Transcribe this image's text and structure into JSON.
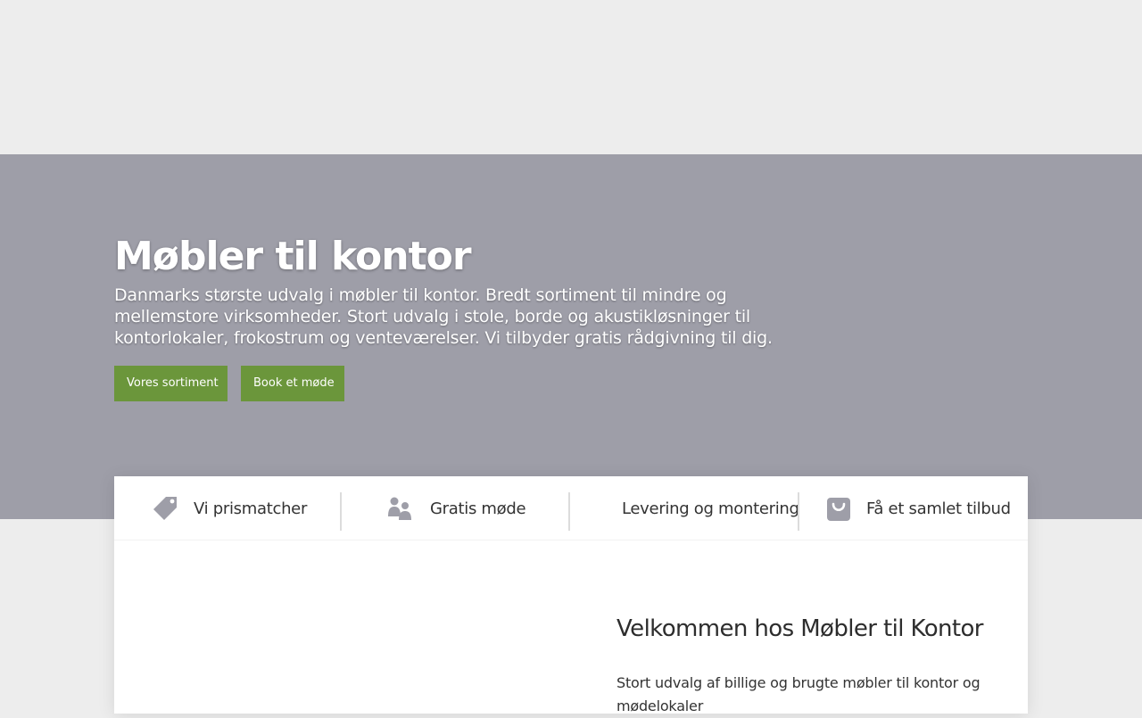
{
  "hero": {
    "title": "Møbler til kontor",
    "subtitle": "Danmarks største udvalg i møbler til kontor. Bredt sortiment til mindre og mellemstore virksomheder. Stort udvalg i stole, borde og akustikløsninger til kontorlokaler, frokostrum og venteværelser. Vi tilbyder gratis rådgivning til dig.",
    "buttons": [
      {
        "label": "Vores sortiment"
      },
      {
        "label": "Book et møde"
      }
    ],
    "background_color": "#9e9ea8",
    "button_color": "#6b963b"
  },
  "features": [
    {
      "label": "Vi prismatcher",
      "icon": "price-tag-icon"
    },
    {
      "label": "Gratis møde",
      "icon": "people-icon"
    },
    {
      "label": "Levering og montering"
    },
    {
      "label": "Få et samlet tilbud",
      "icon": "shopping-bag-icon"
    }
  ],
  "welcome": {
    "title": "Velkommen hos Møbler til Kontor",
    "text": "Stort udvalg af billige og brugte møbler til kontor og mødelokaler"
  },
  "colors": {
    "page_background": "#ededed",
    "icon_gray": "#9e9ea8",
    "text_dark": "#333333"
  }
}
